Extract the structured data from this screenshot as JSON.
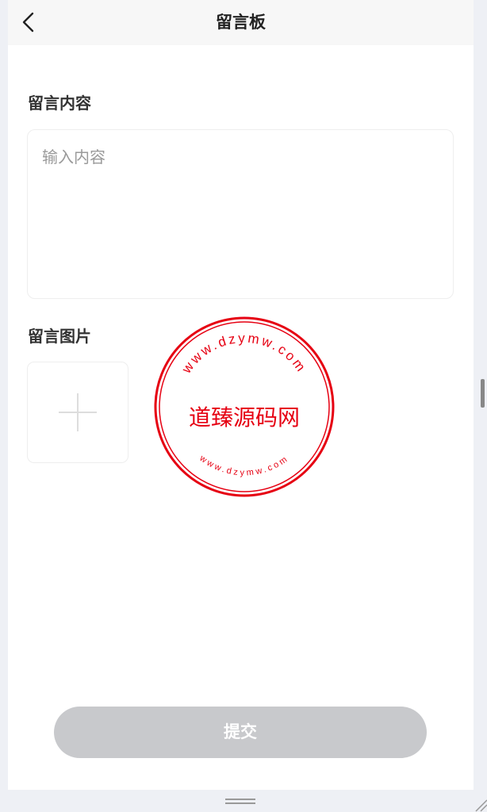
{
  "header": {
    "title": "留言板",
    "back_icon": "chevron-left-icon"
  },
  "form": {
    "content_label": "留言内容",
    "content_placeholder": "输入内容",
    "content_value": "",
    "images_label": "留言图片",
    "upload_icon": "plus-icon",
    "submit_label": "提交"
  },
  "watermark": {
    "center_text": "道臻源码网",
    "ring_text_top": "www.dzymw.com",
    "ring_text_bottom": "www.dzymw.com",
    "color": "#e60012"
  },
  "colors": {
    "header_bg": "#f7f7f7",
    "submit_disabled": "#c8c9cc",
    "placeholder": "#9a9a9a"
  }
}
